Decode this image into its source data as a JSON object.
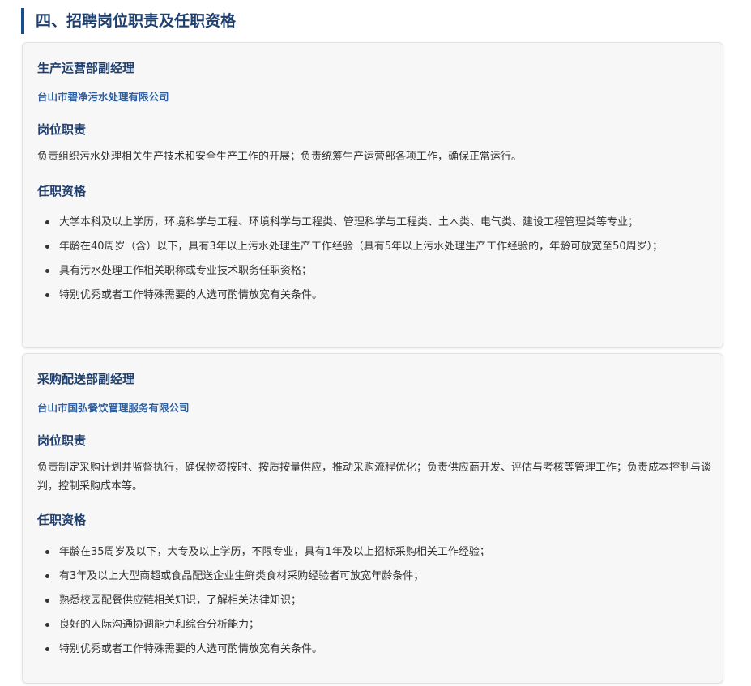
{
  "section": {
    "heading": "四、招聘岗位职责及任职资格"
  },
  "jobs": [
    {
      "title": "生产运营部副经理",
      "company": "台山市碧净污水处理有限公司",
      "duties_heading": "岗位职责",
      "duties": "负责组织污水处理相关生产技术和安全生产工作的开展；负责统筹生产运营部各项工作，确保正常运行。",
      "qualifications_heading": "任职资格",
      "qualifications": [
        "大学本科及以上学历，环境科学与工程、环境科学与工程类、管理科学与工程类、土木类、电气类、建设工程管理类等专业；",
        "年龄在40周岁（含）以下，具有3年以上污水处理生产工作经验（具有5年以上污水处理生产工作经验的，年龄可放宽至50周岁）；",
        "具有污水处理工作相关职称或专业技术职务任职资格；",
        "特别优秀或者工作特殊需要的人选可酌情放宽有关条件。"
      ]
    },
    {
      "title": "采购配送部副经理",
      "company": "台山市国弘餐饮管理服务有限公司",
      "duties_heading": "岗位职责",
      "duties": "负责制定采购计划并监督执行，确保物资按时、按质按量供应，推动采购流程优化；负责供应商开发、评估与考核等管理工作；负责成本控制与谈判，控制采购成本等。",
      "qualifications_heading": "任职资格",
      "qualifications": [
        "年龄在35周岁及以下，大专及以上学历，不限专业，具有1年及以上招标采购相关工作经验；",
        "有3年及以上大型商超或食品配送企业生鲜类食材采购经验者可放宽年龄条件；",
        "熟悉校园配餐供应链相关知识，了解相关法律知识；",
        "良好的人际沟通协调能力和综合分析能力；",
        "特别优秀或者工作特殊需要的人选可酌情放宽有关条件。"
      ]
    }
  ]
}
